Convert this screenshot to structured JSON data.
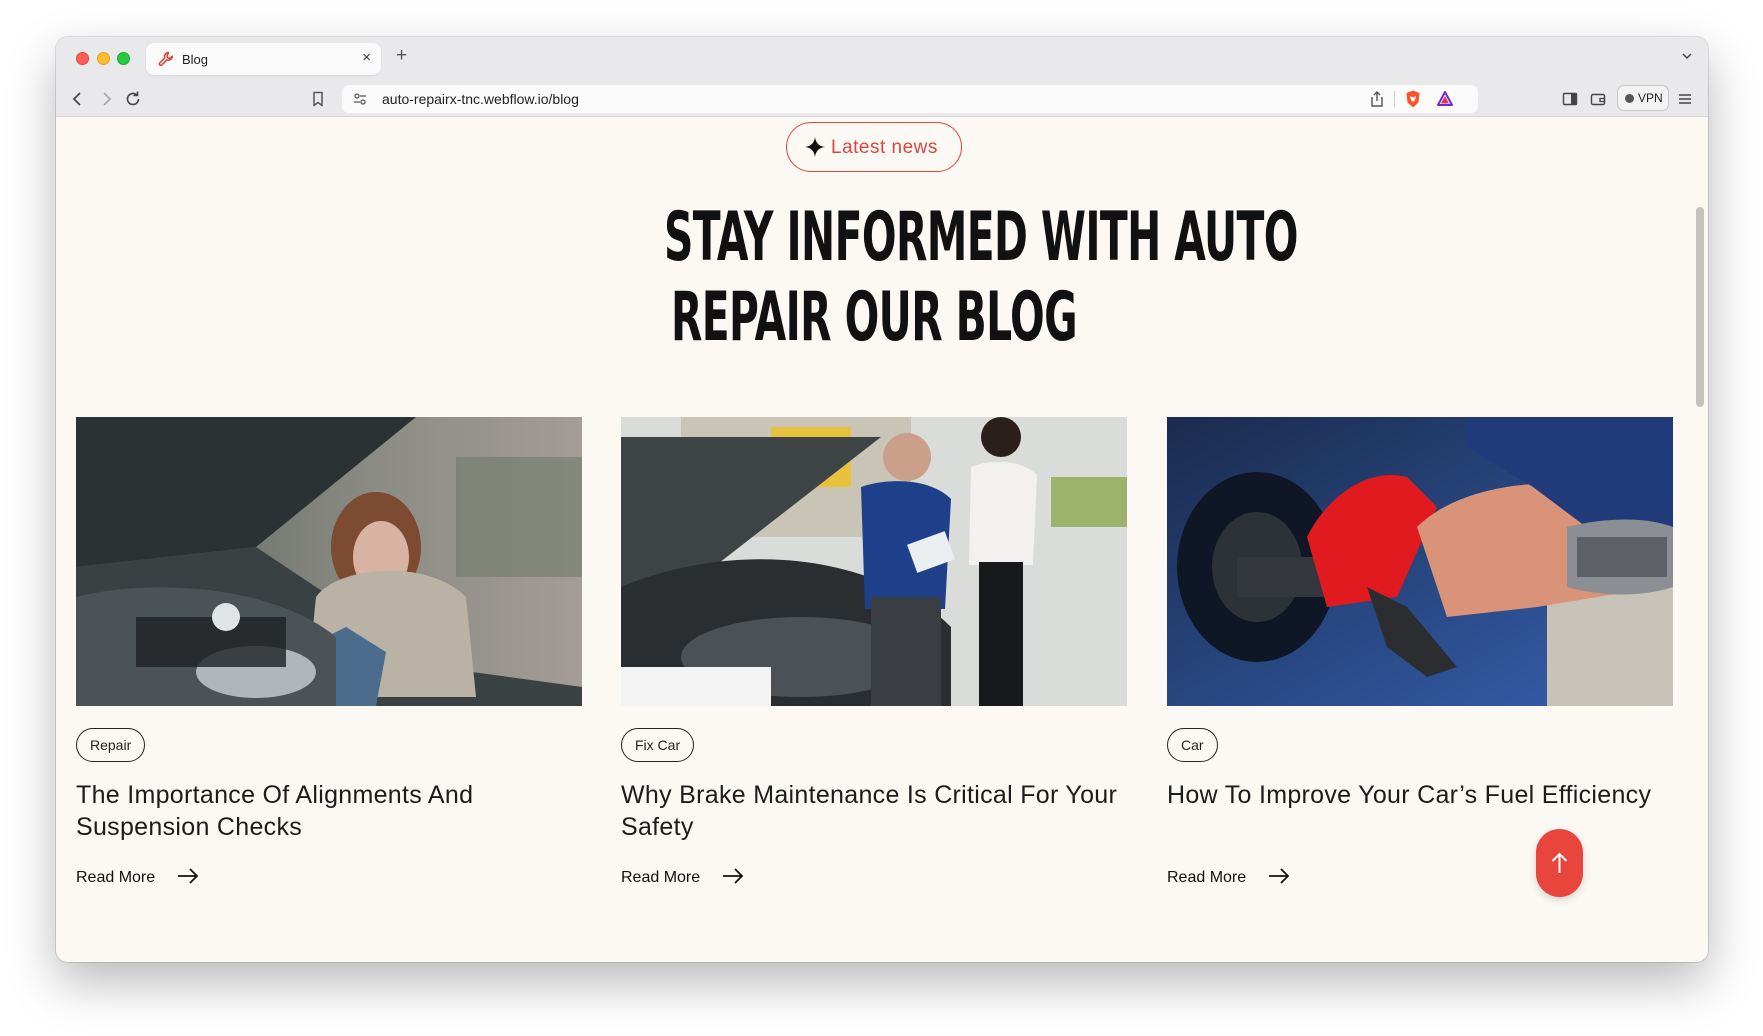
{
  "browser": {
    "tab_title": "Blog",
    "url": "auto-repairx-tnc.webflow.io/blog",
    "vpn_label": "VPN",
    "accent_color": "#d9473f"
  },
  "hero": {
    "badge_label": "Latest news",
    "headline_line1": "STAY INFORMED WITH AUTO",
    "headline_line2": "REPAIR OUR BLOG"
  },
  "posts": [
    {
      "tag": "Repair",
      "title": "The Importance Of Alignments And Suspension Checks",
      "cta": "Read More"
    },
    {
      "tag": "Fix Car",
      "title": "Why Brake Maintenance Is Critical For Your Safety",
      "cta": "Read More"
    },
    {
      "tag": "Car",
      "title": "How To Improve Your Car’s Fuel Efficiency",
      "cta": "Read More"
    }
  ]
}
